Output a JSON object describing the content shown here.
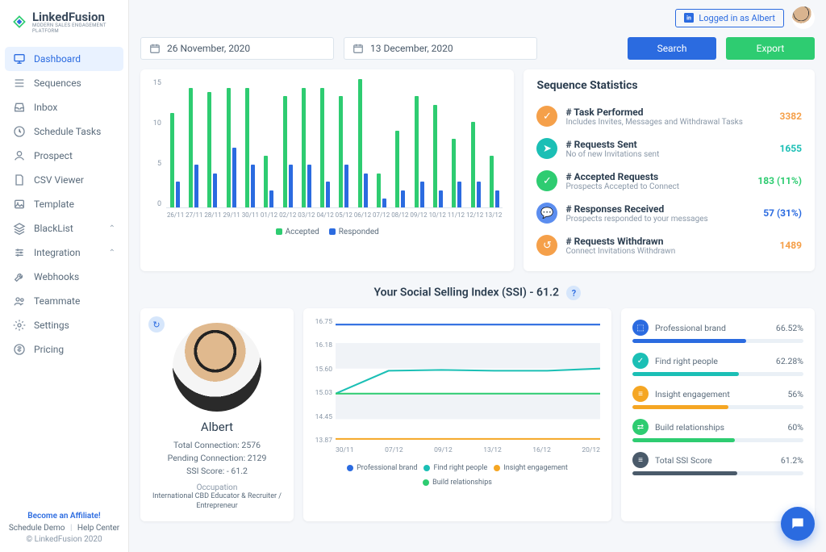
{
  "brand": {
    "name": "LinkedFusion",
    "tagline": "MODERN SALES ENGAGEMENT PLATFORM"
  },
  "login": {
    "text": "Logged in as Albert"
  },
  "nav": [
    {
      "label": "Dashboard",
      "icon": "monitor",
      "active": true
    },
    {
      "label": "Sequences",
      "icon": "list"
    },
    {
      "label": "Inbox",
      "icon": "inbox"
    },
    {
      "label": "Schedule Tasks",
      "icon": "clock"
    },
    {
      "label": "Prospect",
      "icon": "user"
    },
    {
      "label": "CSV Viewer",
      "icon": "file"
    },
    {
      "label": "Template",
      "icon": "image"
    },
    {
      "label": "BlackList",
      "icon": "layers",
      "expandable": true
    },
    {
      "label": "Integration",
      "icon": "sliders",
      "expandable": true
    },
    {
      "label": "Webhooks",
      "icon": "tool"
    },
    {
      "label": "Teammate",
      "icon": "users"
    },
    {
      "label": "Settings",
      "icon": "gear"
    },
    {
      "label": "Pricing",
      "icon": "dollar"
    }
  ],
  "footer": {
    "affiliate": "Become an Affiliate!",
    "schedule": "Schedule Demo",
    "help": "Help Center",
    "copy": "© LinkedFusion 2020"
  },
  "dates": {
    "from": "26 November, 2020",
    "to": "13 December, 2020"
  },
  "buttons": {
    "search": "Search",
    "export": "Export"
  },
  "chart_data": {
    "bar": {
      "type": "bar",
      "categories": [
        "26/11",
        "27/11",
        "28/11",
        "29/11",
        "30/11",
        "01/12",
        "02/12",
        "03/12",
        "04/12",
        "05/12",
        "06/12",
        "07/12",
        "08/12",
        "09/12",
        "10/12",
        "11/12",
        "12/12",
        "13/12"
      ],
      "series": [
        {
          "name": "Accepted",
          "values": [
            11,
            14,
            13.5,
            14,
            14,
            6,
            13,
            14,
            14,
            13,
            15,
            4,
            9,
            13,
            12,
            8,
            10,
            6
          ]
        },
        {
          "name": "Responded",
          "values": [
            3,
            5,
            4,
            7,
            5,
            2,
            5,
            5,
            3,
            5,
            4,
            1,
            2,
            3,
            2,
            3,
            3,
            2
          ]
        }
      ],
      "ylim": [
        0,
        15
      ],
      "yticks": [
        0,
        5,
        10,
        15
      ],
      "legend": {
        "accepted": "Accepted",
        "responded": "Responded"
      }
    },
    "line": {
      "type": "line",
      "x": [
        "30/11",
        "07/12",
        "09/12",
        "13/12",
        "16/12",
        "20/12"
      ],
      "yticks": [
        13.87,
        14.45,
        15.03,
        15.6,
        16.18,
        16.75
      ],
      "series": [
        {
          "name": "Professional brand",
          "color": "#2b6be0",
          "values": [
            16.6,
            16.6,
            16.6,
            16.6,
            16.6,
            16.6
          ]
        },
        {
          "name": "Find right people",
          "color": "#1bbfb5",
          "values": [
            15.03,
            15.55,
            15.57,
            15.55,
            15.55,
            15.6
          ]
        },
        {
          "name": "Insight engagement",
          "color": "#f5a623",
          "values": [
            14.0,
            14.0,
            14.0,
            14.0,
            14.0,
            14.0
          ]
        },
        {
          "name": "Build relationships",
          "color": "#2ecc71",
          "values": [
            15.03,
            15.03,
            15.03,
            15.03,
            15.03,
            15.03
          ]
        }
      ]
    }
  },
  "stats": {
    "title": "Sequence Statistics",
    "items": [
      {
        "icon": "✓",
        "color": "#f5a04a",
        "title": "# Task Performed",
        "sub": "Includes Invites, Messages and Withdrawal Tasks",
        "value": "3382",
        "vcolor": "#f5a04a"
      },
      {
        "icon": "➤",
        "color": "#1bbfb5",
        "title": "# Requests Sent",
        "sub": "No of new Invitations sent",
        "value": "1655",
        "vcolor": "#1bbfb5"
      },
      {
        "icon": "✓",
        "color": "#2ecc71",
        "title": "# Accepted Requests",
        "sub": "Prospects Accepted to Connect",
        "value": "183 (11%)",
        "vcolor": "#2ecc71"
      },
      {
        "icon": "💬",
        "color": "#5b8def",
        "title": "# Responses Received",
        "sub": "Prospects responded to your messages",
        "value": "57 (31%)",
        "vcolor": "#2b6be0"
      },
      {
        "icon": "↺",
        "color": "#f5a04a",
        "title": "# Requests Withdrawn",
        "sub": "Connect Invitations Withdrawn",
        "value": "1489",
        "vcolor": "#f5a04a"
      }
    ]
  },
  "ssi": {
    "title": "Your Social Selling Index (SSI) - 61.2"
  },
  "profile": {
    "name": "Albert",
    "total_conn": "Total Connection: 2576",
    "pending_conn": "Pending Connection: 2129",
    "ssi_score": "SSI Score: - 61.2",
    "occ_label": "Occupation",
    "occupation": "International CBD Educator & Recruiter / Entrepreneur"
  },
  "metrics": [
    {
      "name": "Professional brand",
      "value": "66.52%",
      "pct": 66.5,
      "color": "#2b6be0",
      "icon": "⬚"
    },
    {
      "name": "Find right people",
      "value": "62.28%",
      "pct": 62.3,
      "color": "#1bbfb5",
      "icon": "✓"
    },
    {
      "name": "Insight engagement",
      "value": "56%",
      "pct": 56,
      "color": "#f5a623",
      "icon": "≡"
    },
    {
      "name": "Build relationships",
      "value": "60%",
      "pct": 60,
      "color": "#2ecc71",
      "icon": "⇄"
    },
    {
      "name": "Total SSI Score",
      "value": "61.2%",
      "pct": 61.2,
      "color": "#4a5a6a",
      "icon": "≡"
    }
  ]
}
